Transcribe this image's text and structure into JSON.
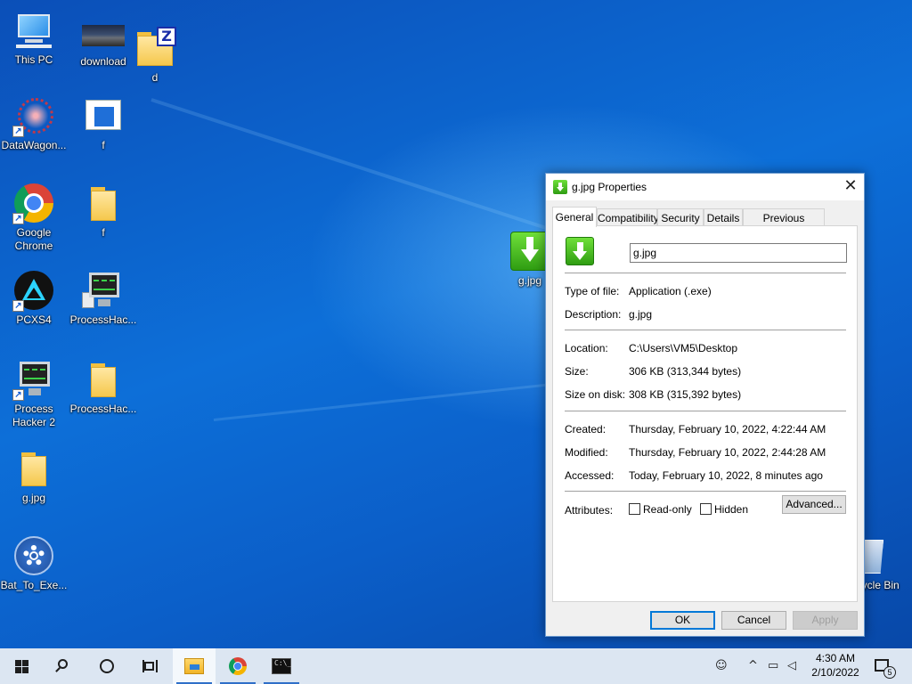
{
  "desktop": {
    "icons": [
      {
        "label": "This PC"
      },
      {
        "label": "download"
      },
      {
        "label": "d"
      },
      {
        "label": "DataWagon..."
      },
      {
        "label": "f"
      },
      {
        "label": "Google Chrome"
      },
      {
        "label": "f"
      },
      {
        "label": "PCXS4"
      },
      {
        "label": "ProcessHac..."
      },
      {
        "label": "Process Hacker 2"
      },
      {
        "label": "ProcessHac..."
      },
      {
        "label": "g.jpg"
      },
      {
        "label": "Bat_To_Exe..."
      },
      {
        "label": "g.jpg"
      },
      {
        "label": "Recycle Bin"
      }
    ]
  },
  "dialog": {
    "title": "g.jpg Properties",
    "close_glyph": "✕",
    "tabs": [
      "General",
      "Compatibility",
      "Security",
      "Details",
      "Previous Versions"
    ],
    "file_name": "g.jpg",
    "rows": {
      "type_label": "Type of file:",
      "type_value": "Application (.exe)",
      "desc_label": "Description:",
      "desc_value": "g.jpg",
      "loc_label": "Location:",
      "loc_value": "C:\\Users\\VM5\\Desktop",
      "size_label": "Size:",
      "size_value": "306 KB (313,344 bytes)",
      "disk_label": "Size on disk:",
      "disk_value": "308 KB (315,392 bytes)",
      "created_label": "Created:",
      "created_value": "Thursday, February 10, 2022, 4:22:44 AM",
      "modified_label": "Modified:",
      "modified_value": "Thursday, February 10, 2022, 2:44:28 AM",
      "accessed_label": "Accessed:",
      "accessed_value": "Today, February 10, 2022, 8 minutes ago",
      "attr_label": "Attributes:"
    },
    "readonly_label": "Read-only",
    "hidden_label": "Hidden",
    "advanced_label": "Advanced...",
    "ok_label": "OK",
    "cancel_label": "Cancel",
    "apply_label": "Apply"
  },
  "taskbar": {
    "time": "4:30 AM",
    "date": "2/10/2022",
    "notification_count": "5",
    "cmd_glyph": "C:\\_"
  }
}
